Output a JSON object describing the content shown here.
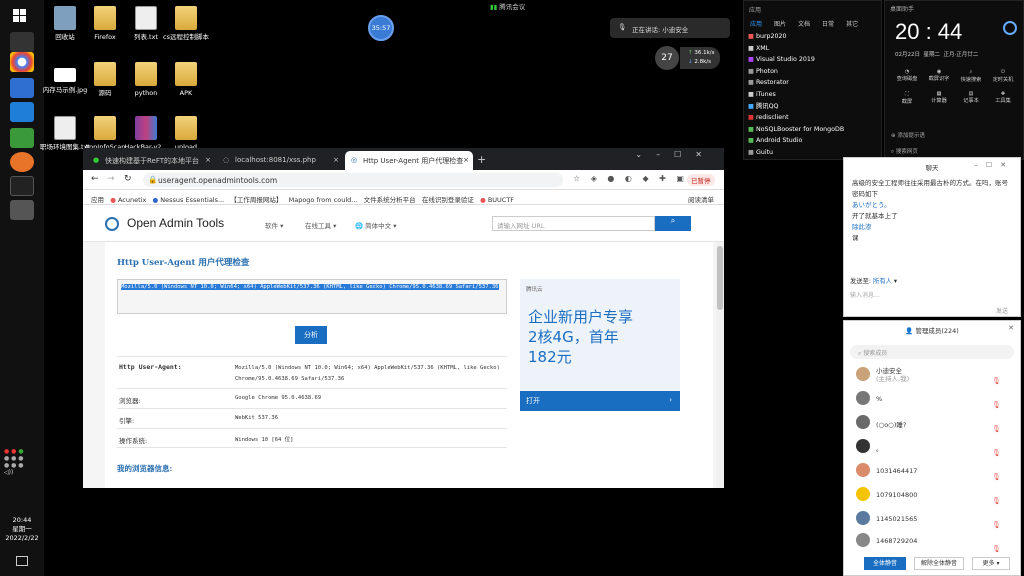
{
  "desktop": {
    "icons": [
      {
        "label": "回收站",
        "icon": "recycle-bin-icon"
      },
      {
        "label": "Firefox",
        "icon": "folder-icon"
      },
      {
        "label": "列表.txt",
        "icon": "text-file-icon"
      },
      {
        "label": "cs远程控制脚本",
        "icon": "folder-icon"
      },
      {
        "label": "内存马示例.jpg",
        "icon": "image-file-icon"
      },
      {
        "label": "源码",
        "icon": "folder-icon"
      },
      {
        "label": "python",
        "icon": "folder-icon"
      },
      {
        "label": "APK",
        "icon": "folder-icon"
      },
      {
        "label": "职场环境图集.txt",
        "icon": "text-file-icon"
      },
      {
        "label": "AppInfoScan",
        "icon": "folder-icon"
      },
      {
        "label": "HackBar-v2...",
        "icon": "rar-icon"
      },
      {
        "label": "upload",
        "icon": "folder-icon"
      }
    ],
    "timer_badge": "35:57",
    "meeting_label": "腾讯会议",
    "speaking_text": "正在讲话: 小迪安全",
    "net_percent": "27",
    "net_up": "36.1k/s",
    "net_down": "2.8k/s"
  },
  "taskbar": {
    "time": "20:44",
    "weekday": "星期一",
    "date": "2022/2/22"
  },
  "browser": {
    "tabs": [
      {
        "label": "快速构建基于ReFT的本地平台"
      },
      {
        "label": "localhost:8081/xss.php"
      },
      {
        "label": "Http User-Agent 用户代理检查"
      }
    ],
    "url": "useragent.openadmintools.com",
    "paused_label": "已暂停",
    "bookmarks": [
      "应用",
      "Acunetix",
      "Nessus Essentials...",
      "【工作周报网站】",
      "Mapogo from could...",
      "文件系统分析平台",
      "在线识别登录验证",
      "BUUCTF",
      "阅读清单"
    ],
    "site": {
      "logo": "Open Admin Tools",
      "nav": [
        "软件",
        "在线工具",
        "简体中文"
      ],
      "search_placeholder": "请输入网址 URL",
      "page_title": "Http User-Agent 用户代理检查",
      "ua_input": "Mozilla/5.0 (Windows NT 10.0; Win64; x64) AppleWebKit/537.36 (KHTML, like Gecko) Chrome/95.0.4638.69 Safari/537.36",
      "analyze_button": "分析",
      "results": [
        {
          "label": "Http User-Agent:",
          "value": "Mozilla/5.0 (Windows NT 10.0; Win64; x64) AppleWebKit/537.36 (KHTML, like Gecko) Chrome/95.0.4638.69 Safari/537.36"
        },
        {
          "label": "浏览器:",
          "value": "Google Chrome 95.0.4638.69"
        },
        {
          "label": "引擎:",
          "value": "WebKit 537.36"
        },
        {
          "label": "操作系统:",
          "value": "Windows 10 [64 位]"
        }
      ],
      "my_browser_info": "我的浏览器信息:",
      "ad": {
        "tag": "腾讯云",
        "line1": "企业新用户专享",
        "line2": "2核4G，首年",
        "line3": "182元",
        "cta": "打开"
      }
    }
  },
  "apps_panel": {
    "tabs": [
      "应用",
      "图片",
      "文档",
      "日常",
      "其它"
    ],
    "items": [
      "burp2020",
      "XML",
      "Visual Studio 2019",
      "Photon",
      "Restorator",
      "iTunes",
      "腾讯QQ",
      "redisclient",
      "NoSQLBooster for MongoDB",
      "Android Studio",
      "Guitu"
    ]
  },
  "clock_widget": {
    "title": "桌面助手",
    "time": "20 : 44",
    "date": "02月22日",
    "weekday": "星期二",
    "lunar": "正月·正月廿二",
    "tools": [
      "查询磁盘",
      "截屏识字",
      "快速搜索",
      "定时关机",
      "截屏",
      "计算器",
      "记事本",
      "工具集"
    ],
    "note": "添加提示语",
    "search_hint": "搜索网页"
  },
  "chat": {
    "title": "聊天",
    "messages": [
      "高级的安全工程师往往采用最古朴的方式。在吗，账号密码如下",
      "あいがとう。",
      "开了就基本上了",
      "除此渗",
      "课"
    ],
    "send_to_label": "发送至:",
    "send_to_value": "所有人",
    "input_placeholder": "输入消息...",
    "send_button": "发送"
  },
  "members": {
    "title": "管理成员(224)",
    "search_placeholder": "搜索成员",
    "list": [
      {
        "name": "小迪安全",
        "sub": "(主持人,我)",
        "color": "#caa27a"
      },
      {
        "name": "%",
        "sub": "",
        "color": "#777"
      },
      {
        "name": "(○o○)睡?",
        "sub": "",
        "color": "#6a6a6a"
      },
      {
        "name": "。",
        "sub": "",
        "color": "#333"
      },
      {
        "name": "1031464417",
        "sub": "",
        "color": "#d98b6a"
      },
      {
        "name": "1079104800",
        "sub": "",
        "color": "#f5c400"
      },
      {
        "name": "1145021565",
        "sub": "",
        "color": "#5a7aa0"
      },
      {
        "name": "1468729204",
        "sub": "",
        "color": "#888"
      }
    ],
    "mute_all": "全体静音",
    "unmute_all": "解除全体静音",
    "more": "更多"
  }
}
